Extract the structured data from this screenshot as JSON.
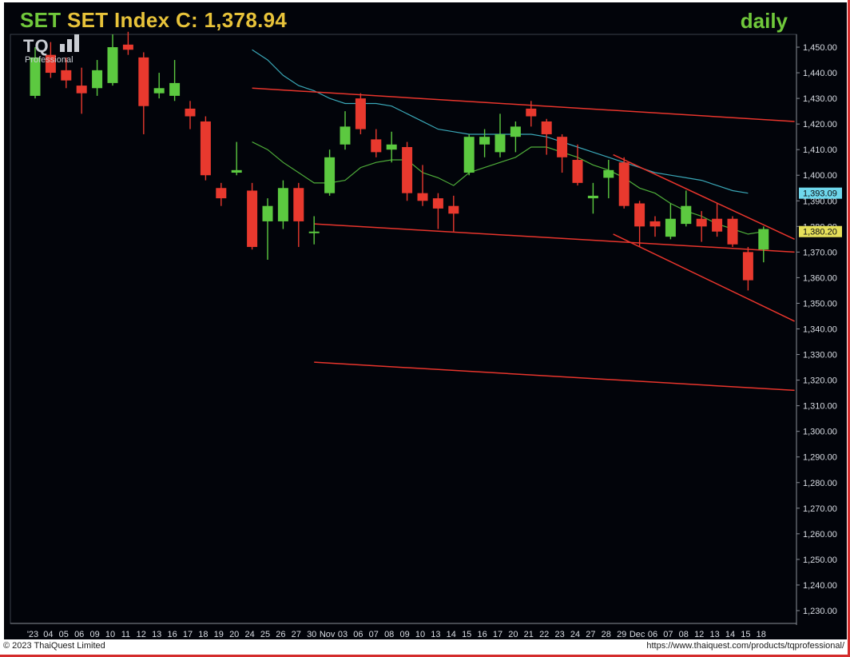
{
  "title": {
    "symbol": "SET",
    "name": "SET Index",
    "close_label": "C:",
    "close_value": "1,378.94",
    "interval": "daily"
  },
  "logo": {
    "text": "TQ",
    "subtext": "Professional"
  },
  "footer": {
    "copyright": "© 2023 ThaiQuest Limited",
    "url": "https://www.thaiquest.com/products/tqprofessional/"
  },
  "colors": {
    "background": "#02040a",
    "up": "#5cc940",
    "down": "#e8392e",
    "sma_short": "#4fae3a",
    "sma_long": "#3aa7b7",
    "trendline": "#e8352c",
    "tag_long": "#6fd7ec",
    "tag_short": "#e6e05a"
  },
  "chart_data": {
    "type": "candlestick",
    "ylim": [
      1225,
      1455
    ],
    "y_ticks": [
      1230,
      1240,
      1250,
      1260,
      1270,
      1280,
      1290,
      1300,
      1310,
      1320,
      1330,
      1340,
      1350,
      1360,
      1370,
      1380,
      1390,
      1400,
      1410,
      1420,
      1430,
      1440,
      1450
    ],
    "x_labels": [
      "'23",
      "04",
      "05",
      "06",
      "09",
      "10",
      "11",
      "12",
      "13",
      "16",
      "17",
      "18",
      "19",
      "20",
      "24",
      "25",
      "26",
      "27",
      "30",
      "Nov",
      "03",
      "06",
      "07",
      "08",
      "09",
      "10",
      "13",
      "14",
      "15",
      "16",
      "17",
      "20",
      "21",
      "22",
      "23",
      "24",
      "27",
      "28",
      "29",
      "Dec",
      "06",
      "07",
      "08",
      "12",
      "13",
      "14",
      "15",
      "18"
    ],
    "candles": [
      {
        "o": 1431,
        "h": 1450,
        "l": 1430,
        "c": 1446
      },
      {
        "o": 1447,
        "h": 1452,
        "l": 1438,
        "c": 1440
      },
      {
        "o": 1441,
        "h": 1446,
        "l": 1434,
        "c": 1437
      },
      {
        "o": 1435,
        "h": 1442,
        "l": 1424,
        "c": 1432
      },
      {
        "o": 1434,
        "h": 1445,
        "l": 1431,
        "c": 1441
      },
      {
        "o": 1436,
        "h": 1455,
        "l": 1435,
        "c": 1450
      },
      {
        "o": 1451,
        "h": 1456,
        "l": 1447,
        "c": 1449
      },
      {
        "o": 1446,
        "h": 1448,
        "l": 1416,
        "c": 1427
      },
      {
        "o": 1432,
        "h": 1440,
        "l": 1430,
        "c": 1434
      },
      {
        "o": 1431,
        "h": 1445,
        "l": 1429,
        "c": 1436
      },
      {
        "o": 1426,
        "h": 1429,
        "l": 1418,
        "c": 1423
      },
      {
        "o": 1421,
        "h": 1423,
        "l": 1398,
        "c": 1400
      },
      {
        "o": 1395,
        "h": 1397,
        "l": 1388,
        "c": 1391
      },
      {
        "o": 1401,
        "h": 1413,
        "l": 1400,
        "c": 1402
      },
      {
        "o": 1394,
        "h": 1397,
        "l": 1371,
        "c": 1372
      },
      {
        "o": 1382,
        "h": 1391,
        "l": 1367,
        "c": 1388
      },
      {
        "o": 1382,
        "h": 1398,
        "l": 1379,
        "c": 1395
      },
      {
        "o": 1395,
        "h": 1397,
        "l": 1372,
        "c": 1382
      },
      {
        "o": 1378,
        "h": 1384,
        "l": 1373,
        "c": 1378
      },
      {
        "o": 1393,
        "h": 1410,
        "l": 1392,
        "c": 1407
      },
      {
        "o": 1412,
        "h": 1425,
        "l": 1410,
        "c": 1419
      },
      {
        "o": 1430,
        "h": 1432,
        "l": 1416,
        "c": 1418
      },
      {
        "o": 1414,
        "h": 1418,
        "l": 1407,
        "c": 1409
      },
      {
        "o": 1410,
        "h": 1417,
        "l": 1405,
        "c": 1412
      },
      {
        "o": 1411,
        "h": 1413,
        "l": 1390,
        "c": 1393
      },
      {
        "o": 1393,
        "h": 1404,
        "l": 1388,
        "c": 1390
      },
      {
        "o": 1391,
        "h": 1393,
        "l": 1379,
        "c": 1387
      },
      {
        "o": 1388,
        "h": 1392,
        "l": 1378,
        "c": 1385
      },
      {
        "o": 1401,
        "h": 1416,
        "l": 1400,
        "c": 1415
      },
      {
        "o": 1412,
        "h": 1418,
        "l": 1407,
        "c": 1415
      },
      {
        "o": 1409,
        "h": 1424,
        "l": 1407,
        "c": 1416
      },
      {
        "o": 1415,
        "h": 1421,
        "l": 1409,
        "c": 1419
      },
      {
        "o": 1426,
        "h": 1429,
        "l": 1419,
        "c": 1423
      },
      {
        "o": 1421,
        "h": 1422,
        "l": 1408,
        "c": 1416
      },
      {
        "o": 1415,
        "h": 1416,
        "l": 1401,
        "c": 1407
      },
      {
        "o": 1406,
        "h": 1412,
        "l": 1396,
        "c": 1397
      },
      {
        "o": 1391,
        "h": 1397,
        "l": 1385,
        "c": 1392
      },
      {
        "o": 1399,
        "h": 1406,
        "l": 1391,
        "c": 1402
      },
      {
        "o": 1405,
        "h": 1407,
        "l": 1387,
        "c": 1388
      },
      {
        "o": 1389,
        "h": 1390,
        "l": 1372,
        "c": 1380
      },
      {
        "o": 1382,
        "h": 1384,
        "l": 1376,
        "c": 1380
      },
      {
        "o": 1376,
        "h": 1389,
        "l": 1375,
        "c": 1383
      },
      {
        "o": 1381,
        "h": 1394,
        "l": 1380,
        "c": 1388
      },
      {
        "o": 1383,
        "h": 1386,
        "l": 1374,
        "c": 1380
      },
      {
        "o": 1383,
        "h": 1389,
        "l": 1376,
        "c": 1378
      },
      {
        "o": 1383,
        "h": 1384,
        "l": 1372,
        "c": 1373
      },
      {
        "o": 1370,
        "h": 1372,
        "l": 1355,
        "c": 1359
      },
      {
        "o": 1371,
        "h": 1380,
        "l": 1366,
        "c": 1379
      }
    ],
    "sma_short": [
      null,
      null,
      null,
      null,
      null,
      null,
      null,
      null,
      null,
      null,
      null,
      null,
      null,
      null,
      1413,
      1410,
      1405,
      1401,
      1397,
      1397,
      1398,
      1403,
      1405,
      1406,
      1406,
      1401,
      1399,
      1396,
      1401,
      1403,
      1405,
      1407,
      1411,
      1411,
      1409,
      1407,
      1404,
      1402,
      1399,
      1395,
      1393,
      1389,
      1386,
      1384,
      1381,
      1379,
      1377,
      1378
    ],
    "sma_long": [
      null,
      null,
      null,
      null,
      null,
      null,
      null,
      null,
      null,
      null,
      null,
      null,
      null,
      null,
      1449,
      1445,
      1439,
      1435,
      1433,
      1430,
      1428,
      1428,
      1428,
      1427,
      1424,
      1421,
      1418,
      1417,
      1416,
      1416,
      1416,
      1416,
      1416,
      1415,
      1413,
      1411,
      1409,
      1407,
      1405,
      1403,
      1401,
      1400,
      1399,
      1398,
      1396,
      1394,
      1393,
      null
    ],
    "last_values": {
      "sma_long": "1,393.09",
      "sma_short": "1,380.20"
    },
    "trendlines": [
      {
        "x1": 14.0,
        "y1": 1434,
        "x2": 49.0,
        "y2": 1421
      },
      {
        "x1": 18.0,
        "y1": 1381,
        "x2": 49.0,
        "y2": 1370
      },
      {
        "x1": 18.0,
        "y1": 1327,
        "x2": 49.0,
        "y2": 1316
      },
      {
        "x1": 37.3,
        "y1": 1408,
        "x2": 49.0,
        "y2": 1375
      },
      {
        "x1": 37.3,
        "y1": 1377,
        "x2": 49.0,
        "y2": 1343
      }
    ]
  }
}
